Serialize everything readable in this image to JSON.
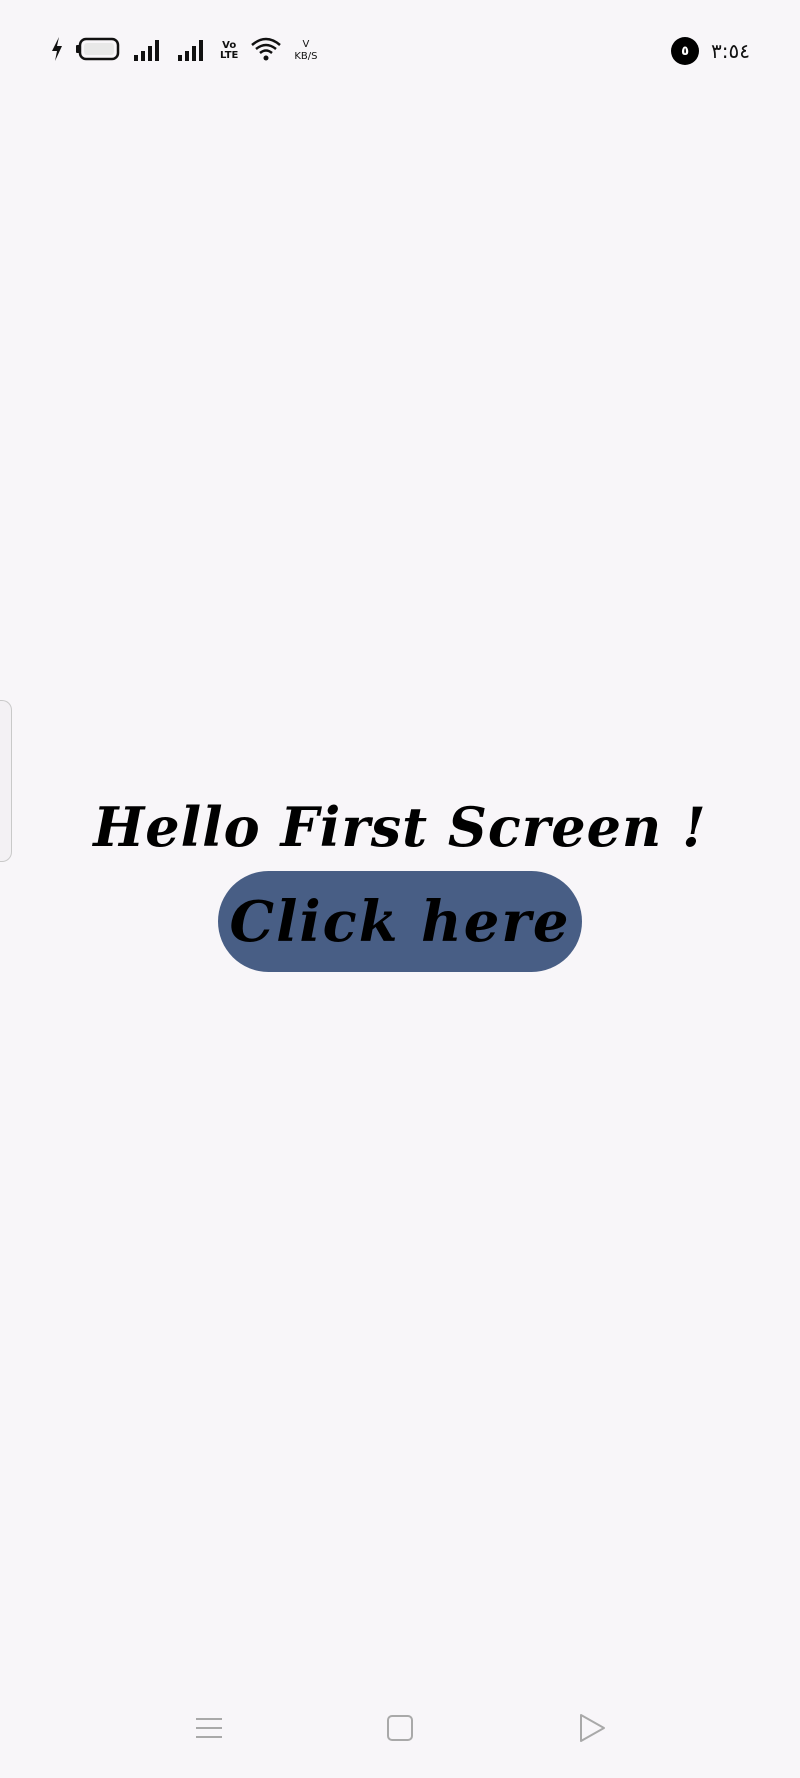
{
  "status_bar": {
    "volte_top": "Vo",
    "volte_bottom": "LTE",
    "net_speed_value": "V",
    "net_speed_unit": "KB/S",
    "notification_count": "٥",
    "time": "٣:٥٤",
    "icons": [
      "charging-icon",
      "battery-icon",
      "signal-icon",
      "signal-icon",
      "volte-icon",
      "wifi-icon"
    ]
  },
  "main": {
    "greeting": "Hello First Screen !",
    "button_label": "Click here",
    "button_color": "#485e85",
    "background_color": "#f8f6f9"
  },
  "nav_bar": {
    "icons": [
      "menu-icon",
      "home-icon",
      "back-icon"
    ]
  }
}
